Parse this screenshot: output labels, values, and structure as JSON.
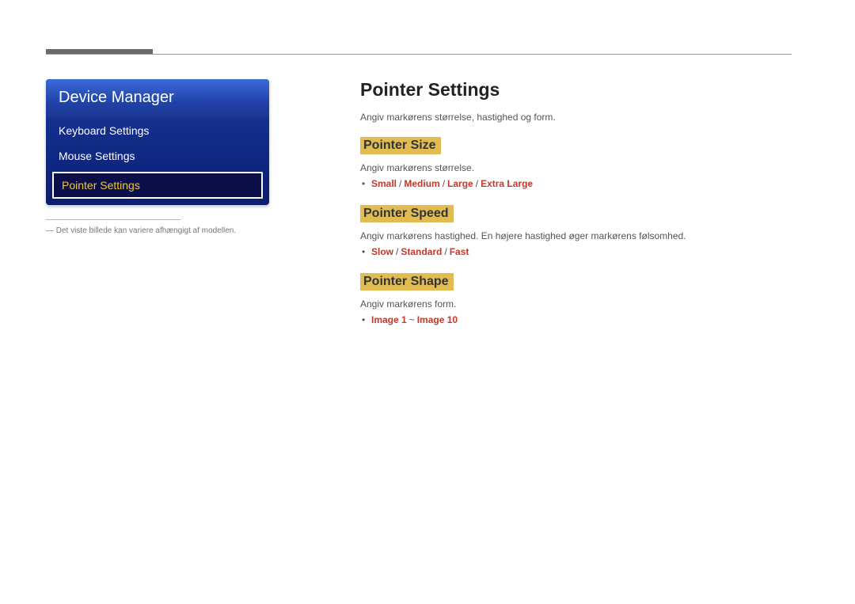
{
  "menu": {
    "header": "Device Manager",
    "items": [
      {
        "label": "Keyboard Settings",
        "selected": false
      },
      {
        "label": "Mouse Settings",
        "selected": false
      },
      {
        "label": "Pointer Settings",
        "selected": true
      }
    ]
  },
  "footnote": "― Det viste billede kan variere afhængigt af modellen.",
  "page": {
    "title": "Pointer Settings",
    "intro": "Angiv markørens størrelse, hastighed og form."
  },
  "sections": {
    "size": {
      "heading": "Pointer Size",
      "desc": "Angiv markørens størrelse.",
      "options": [
        "Small",
        "Medium",
        "Large",
        "Extra Large"
      ],
      "separator": "/"
    },
    "speed": {
      "heading": "Pointer Speed",
      "desc": "Angiv markørens hastighed. En højere hastighed øger markørens følsomhed.",
      "options": [
        "Slow",
        "Standard",
        "Fast"
      ],
      "separator": "/"
    },
    "shape": {
      "heading": "Pointer Shape",
      "desc": "Angiv markørens form.",
      "options": [
        "Image 1",
        "Image 10"
      ],
      "separator": "~"
    }
  }
}
